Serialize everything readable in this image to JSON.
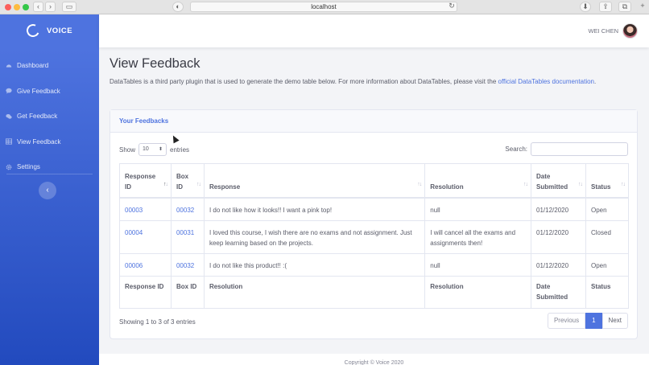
{
  "browser": {
    "url": "localhost"
  },
  "brand": {
    "name": "VOICE"
  },
  "sidebar": {
    "items": [
      {
        "label": "Dashboard",
        "icon": "dashboard-icon"
      },
      {
        "label": "Give Feedback",
        "icon": "comment-icon"
      },
      {
        "label": "Get Feedback",
        "icon": "comments-icon"
      },
      {
        "label": "View Feedback",
        "icon": "table-icon"
      },
      {
        "label": "Settings",
        "icon": "gear-icon"
      }
    ],
    "toggle_glyph": "‹"
  },
  "topbar": {
    "user_name": "WEI CHEN"
  },
  "page": {
    "title": "View Feedback",
    "description": "DataTables is a third party plugin that is used to generate the demo table below. For more information about DataTables, please visit the",
    "description_link": "official DataTables documentation",
    "description_end": "."
  },
  "card": {
    "header": "Your Feedbacks",
    "show_label": "Show",
    "entries_label": "entries",
    "page_length": "10",
    "search_label": "Search:",
    "info": "Showing 1 to 3 of 3 entries",
    "pager": {
      "previous": "Previous",
      "current": "1",
      "next": "Next"
    }
  },
  "table": {
    "headers": [
      "Response ID",
      "Box ID",
      "Response",
      "Resolution",
      "Date Submitted",
      "Status"
    ],
    "footer": [
      "Response ID",
      "Box ID",
      "Resolution",
      "Resolution",
      "Date Submitted",
      "Status"
    ],
    "rows": [
      {
        "response_id": "00003",
        "box_id": "00032",
        "response": "I do not like how it looks!! I want a pink top!",
        "resolution": "null",
        "date": "01/12/2020",
        "status": "Open"
      },
      {
        "response_id": "00004",
        "box_id": "00031",
        "response": "I loved this course, I wish there are no exams and not assignment. Just keep learning based on the projects.",
        "resolution": "I will cancel all the exams and assignments then!",
        "date": "01/12/2020",
        "status": "Closed"
      },
      {
        "response_id": "00006",
        "box_id": "00032",
        "response": "I do not like this product!! :(",
        "resolution": "null",
        "date": "01/12/2020",
        "status": "Open"
      }
    ]
  },
  "footer": {
    "text": "Copyright © Voice 2020"
  },
  "colors": {
    "primary": "#4e73df",
    "sidebar_dark": "#224abe"
  }
}
